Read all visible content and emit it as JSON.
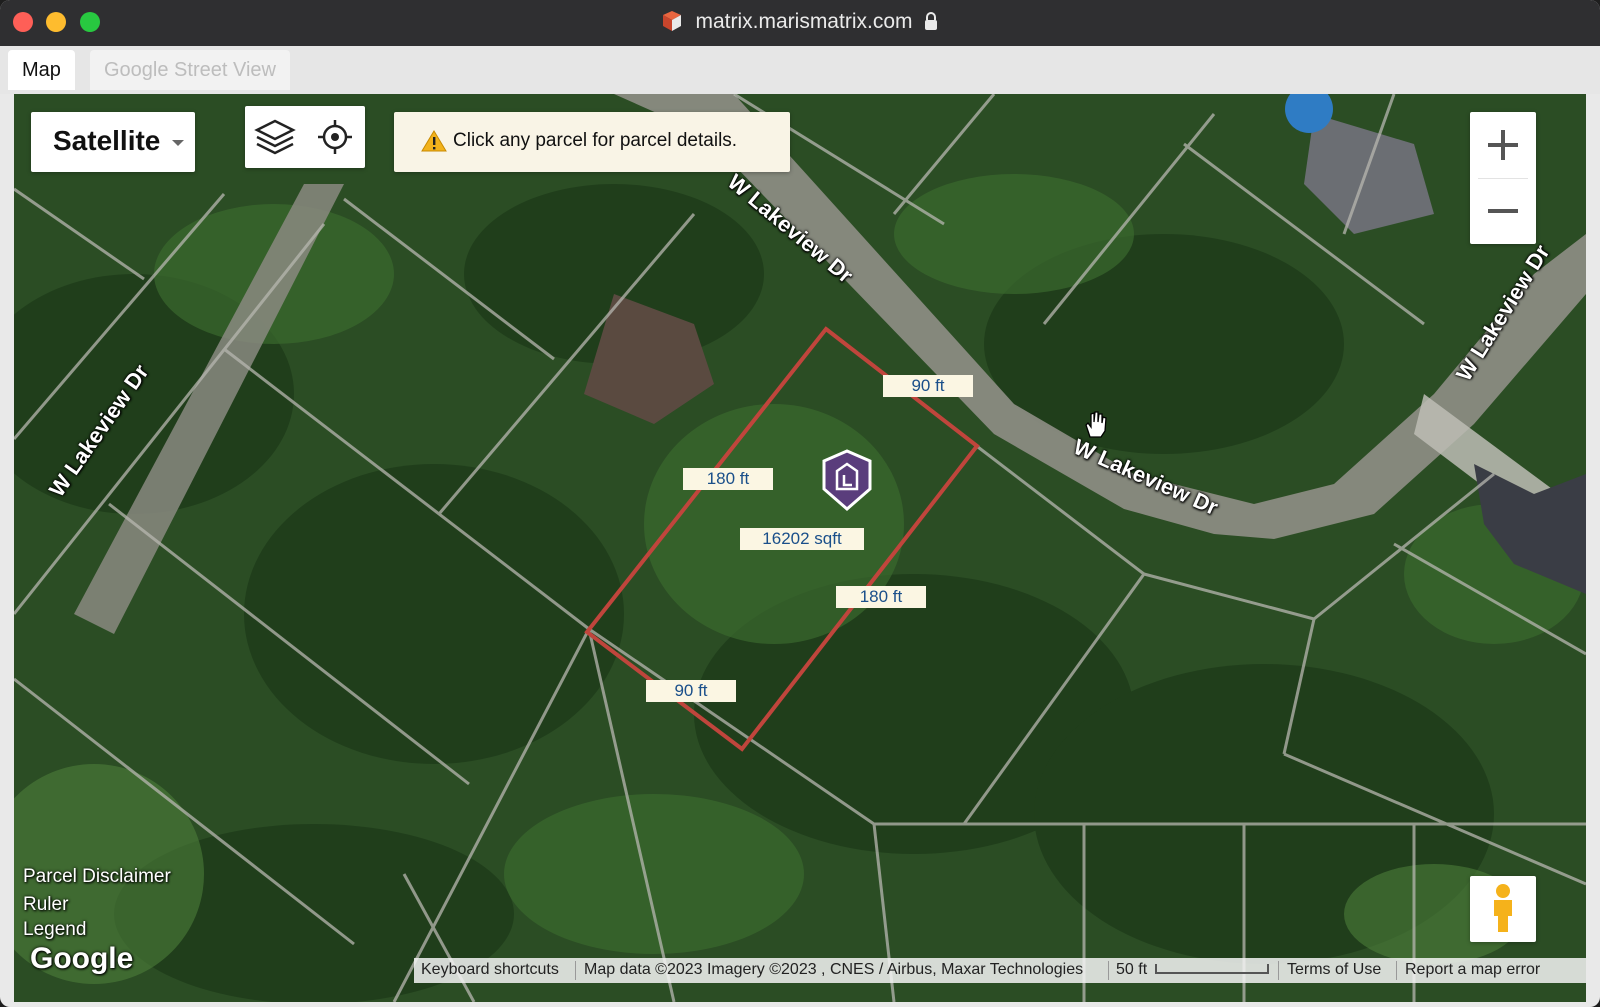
{
  "window": {
    "title": "matrix.marismatrix.com"
  },
  "tabs": [
    {
      "label": "Map",
      "active": true
    },
    {
      "label": "Google Street View",
      "active": false
    }
  ],
  "map": {
    "map_type": "Satellite",
    "notice": "Click any parcel for parcel details.",
    "zoom_in": "+",
    "zoom_out": "−",
    "streets": [
      "W Lakeview Dr",
      "W Lakeview Dr",
      "W Lakeview Dr",
      "W Lakeview Dr"
    ],
    "parcel": {
      "top_side": "90 ft",
      "bottom_side": "90 ft",
      "left_side": "180 ft",
      "right_side": "180 ft",
      "area": "16202 sqft",
      "outline_color": "#c0453c"
    },
    "side_links": [
      "Parcel Disclaimer",
      "Ruler",
      "Legend"
    ],
    "logo": "Google",
    "attribution": {
      "shortcuts": "Keyboard shortcuts",
      "map_data": "Map data ©2023 Imagery ©2023 , CNES / Airbus, Maxar Technologies",
      "scale": "50 ft",
      "terms": "Terms of Use",
      "report": "Report a map error"
    }
  },
  "icons": [
    "site-icon",
    "lock-icon",
    "layers-icon",
    "locate-icon",
    "warning-icon",
    "parcel-marker-icon",
    "hand-cursor-icon",
    "pegman-icon"
  ],
  "colors": {
    "accent": "#5a3d7c",
    "warning": "#f2b21c"
  }
}
